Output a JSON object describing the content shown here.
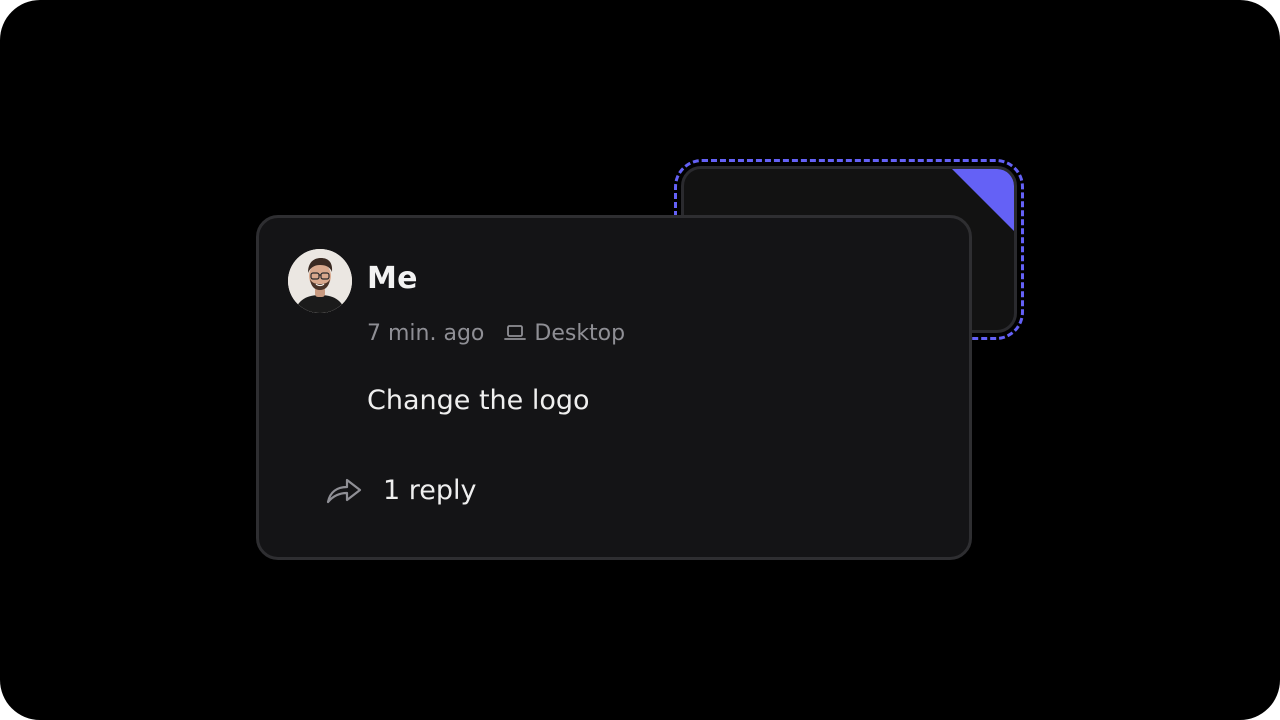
{
  "comment": {
    "author": "Me",
    "time_ago": "7 min. ago",
    "device": "Desktop",
    "device_icon": "laptop-icon",
    "message": "Change the logo",
    "replies_label": "1 reply",
    "reply_icon": "reply-arrow-icon"
  },
  "colors": {
    "background": "#000000",
    "card": "#141416",
    "card_border": "#2e2e31",
    "accent": "#6461f6",
    "muted_text": "#8f8f95",
    "text": "#efefef"
  }
}
